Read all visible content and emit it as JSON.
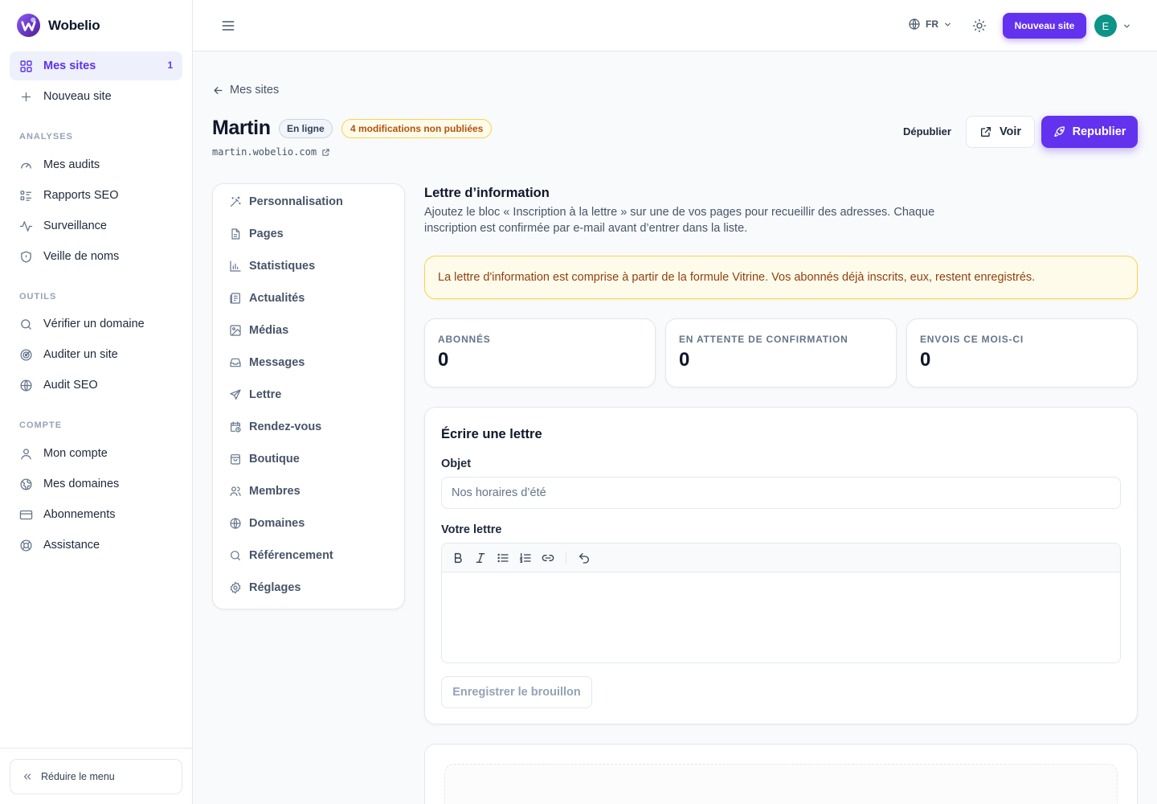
{
  "brand": {
    "name": "Wobelio"
  },
  "sidebar": {
    "main": [
      {
        "label": "Mes sites",
        "badge": "1",
        "icon": "grid-icon"
      },
      {
        "label": "Nouveau site",
        "icon": "plus-icon"
      }
    ],
    "sections": [
      {
        "title": "ANALYSES",
        "items": [
          {
            "label": "Mes audits",
            "icon": "gauge-icon"
          },
          {
            "label": "Rapports SEO",
            "icon": "list-icon"
          },
          {
            "label": "Surveillance",
            "icon": "activity-icon"
          },
          {
            "label": "Veille de noms",
            "icon": "shield-icon"
          }
        ]
      },
      {
        "title": "OUTILS",
        "items": [
          {
            "label": "Vérifier un domaine",
            "icon": "search-icon"
          },
          {
            "label": "Auditer un site",
            "icon": "radar-icon"
          },
          {
            "label": "Audit SEO",
            "icon": "globe-icon"
          }
        ]
      },
      {
        "title": "COMPTE",
        "items": [
          {
            "label": "Mon compte",
            "icon": "user-icon"
          },
          {
            "label": "Mes domaines",
            "icon": "world-icon"
          },
          {
            "label": "Abonnements",
            "icon": "credit-card-icon"
          },
          {
            "label": "Assistance",
            "icon": "lifebuoy-icon"
          }
        ]
      }
    ],
    "collapse_label": "Réduire le menu"
  },
  "topbar": {
    "language": "FR",
    "new_site_label": "Nouveau site",
    "avatar_initial": "E"
  },
  "page": {
    "back_label": "Mes sites",
    "site_name": "Martin",
    "status": "En ligne",
    "changes": "4 modifications non publiées",
    "url": "martin.wobelio.com",
    "unpublish_label": "Dépublier",
    "view_label": "Voir",
    "republish_label": "Republier"
  },
  "subnav": [
    {
      "label": "Personnalisation",
      "icon": "wand-icon"
    },
    {
      "label": "Pages",
      "icon": "file-icon"
    },
    {
      "label": "Statistiques",
      "icon": "bar-chart-icon"
    },
    {
      "label": "Actualités",
      "icon": "newspaper-icon"
    },
    {
      "label": "Médias",
      "icon": "image-icon"
    },
    {
      "label": "Messages",
      "icon": "inbox-icon"
    },
    {
      "label": "Lettre",
      "icon": "send-icon"
    },
    {
      "label": "Rendez-vous",
      "icon": "calendar-clock-icon"
    },
    {
      "label": "Boutique",
      "icon": "shopping-bag-icon"
    },
    {
      "label": "Membres",
      "icon": "users-icon"
    },
    {
      "label": "Domaines",
      "icon": "globe-icon"
    },
    {
      "label": "Référencement",
      "icon": "search-icon"
    },
    {
      "label": "Réglages",
      "icon": "settings-icon"
    }
  ],
  "newsletter": {
    "title": "Lettre d’information",
    "description": "Ajoutez le bloc « Inscription à la lettre » sur une de vos pages pour recueillir des adresses. Chaque inscription est confirmée par e-mail avant d’entrer dans la liste.",
    "alert": "La lettre d'information est comprise à partir de la formule Vitrine. Vos abonnés déjà inscrits, eux, restent enregistrés.",
    "stats": [
      {
        "label": "ABONNÉS",
        "value": "0"
      },
      {
        "label": "EN ATTENTE DE CONFIRMATION",
        "value": "0"
      },
      {
        "label": "ENVOIS CE MOIS-CI",
        "value": "0"
      }
    ],
    "compose": {
      "title": "Écrire une lettre",
      "subject_label": "Objet",
      "subject_placeholder": "Nos horaires d’été",
      "body_label": "Votre lettre",
      "save_draft_label": "Enregistrer le brouillon"
    }
  },
  "colors": {
    "accent": "#6232ee",
    "warning_bg": "#fffbeb",
    "warning_text": "#92400e",
    "avatar": "#0d9488"
  }
}
